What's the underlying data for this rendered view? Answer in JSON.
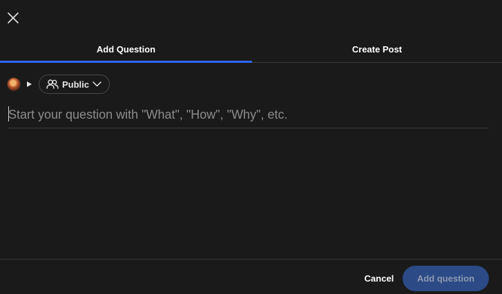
{
  "header": {
    "close_icon": "close-icon"
  },
  "tabs": [
    {
      "label": "Add Question",
      "active": true
    },
    {
      "label": "Create Post",
      "active": false
    }
  ],
  "audience": {
    "avatar_icon": "user-avatar",
    "expand_icon": "caret-right-icon",
    "people_icon": "people-icon",
    "label": "Public",
    "dropdown_icon": "chevron-down-icon"
  },
  "question": {
    "placeholder": "Start your question with \"What\", \"How\", \"Why\", etc.",
    "value": ""
  },
  "footer": {
    "cancel_label": "Cancel",
    "submit_label": "Add question"
  },
  "colors": {
    "background": "#1a1a1a",
    "accent": "#2e69ff",
    "submit_disabled": "#2b4a86",
    "divider": "#393939"
  }
}
